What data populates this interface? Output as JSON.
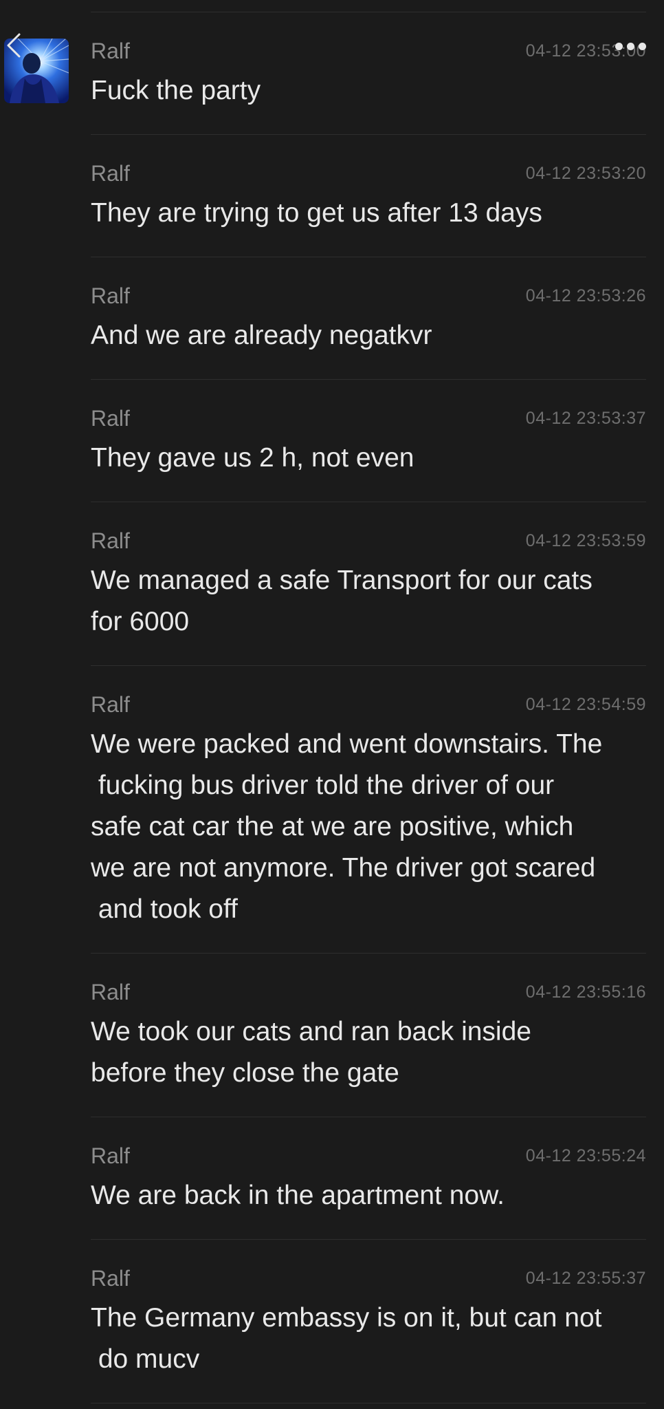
{
  "header": {
    "back_icon": "chevron-left-icon",
    "more_icon": "more-dots-icon"
  },
  "messages": [
    {
      "sender": "Ralf",
      "time": "04-12 23:53:00",
      "text": "Fuck the party",
      "show_avatar": true
    },
    {
      "sender": "Ralf",
      "time": "04-12 23:53:20",
      "text": "They are trying to get us after 13 days"
    },
    {
      "sender": "Ralf",
      "time": "04-12 23:53:26",
      "text": "And we are already negatkvr"
    },
    {
      "sender": "Ralf",
      "time": "04-12 23:53:37",
      "text": "They gave us 2 h, not even"
    },
    {
      "sender": "Ralf",
      "time": "04-12 23:53:59",
      "text": "We managed a safe Transport for our cats\nfor 6000"
    },
    {
      "sender": "Ralf",
      "time": "04-12 23:54:59",
      "text": "We were packed and went downstairs. The\n fucking bus driver told the driver of our\nsafe cat car the at we are positive, which\nwe are not anymore. The driver got scared\n and took off"
    },
    {
      "sender": "Ralf",
      "time": "04-12 23:55:16",
      "text": "We took our cats and ran back inside\nbefore they close the gate"
    },
    {
      "sender": "Ralf",
      "time": "04-12 23:55:24",
      "text": "We are back in the apartment now."
    },
    {
      "sender": "Ralf",
      "time": "04-12 23:55:37",
      "text": "The Germany embassy is on it, but can not\n do mucv"
    }
  ]
}
